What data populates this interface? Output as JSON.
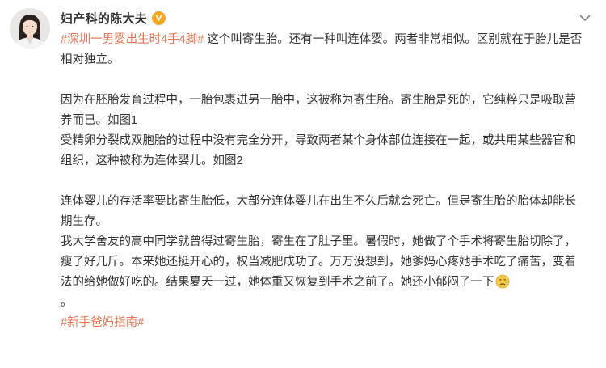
{
  "post": {
    "author": "妇产科的陈大夫",
    "badge": "verified-badge-icon",
    "menu_icon": "chevron-down-icon",
    "topic_hashtag": "#深圳一男婴出生时4手4脚#",
    "para1_rest": " 这个叫寄生胎。还有一种叫连体婴。两者非常相似。区别就在于胎儿是否相对独立。",
    "para2": "因为在胚胎发育过程中，一胎包裹进另一胎中，这被称为寄生胎。寄生胎是死的，它纯粹只是吸取营养而已。如图1",
    "para3": "受精卵分裂成双胞胎的过程中没有完全分开，导致两者某个身体部位连接在一起，或共用某些器官和组织，这种被称为连体婴儿。如图2",
    "para4": "连体婴儿的存活率要比寄生胎低，大部分连体婴儿在出生不久后就会死亡。但是寄生胎的胎体却能长期生存。",
    "para5": "我大学舍友的高中同学就曾得过寄生胎，寄生在了肚子里。暑假时，她做了个手术将寄生胎切除了，瘦了好几斤。本来她还挺开心的，权当减肥成功了。万万没想到，她爹妈心疼她手术吃了痛苦，变着法的给她做好吃的。结果夏天一过，她体重又恢复到手术之前了。她还小郁闷了一下",
    "para5_emoji": "sad-face-emoji-icon",
    "para5_end": "。",
    "footer_hashtag": "#新手爸妈指南#"
  },
  "colors": {
    "link": "#eb7350",
    "text": "#333333",
    "badge": "#f5a623",
    "chevron": "#808080"
  }
}
